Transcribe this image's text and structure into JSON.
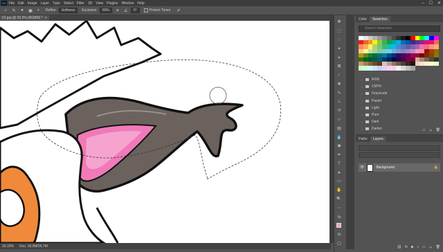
{
  "app": {
    "logo": "Ps"
  },
  "menu": [
    "File",
    "Edit",
    "Image",
    "Layer",
    "Type",
    "Select",
    "Filter",
    "3D",
    "View",
    "Plugins",
    "Window",
    "Help"
  ],
  "window_controls": [
    "–",
    "☐",
    "✕"
  ],
  "options_bar": {
    "feather_label": "Feather:",
    "feather_value": "0 px",
    "antialias_label": "Refine:",
    "mode_label": "Softness",
    "tolerance_label": "Exclusive:",
    "tolerance_value": "50%",
    "angle_value": "0°",
    "protect_label": "Protect Tones"
  },
  "document": {
    "tab_title": "01.jpg @ 33.3% (RGB/8) *",
    "status_zoom": "33.33%",
    "status_info": "Doc: 18.0M/26.7M"
  },
  "tools": [
    "move-icon",
    "marquee-icon",
    "lasso-icon",
    "quick-select-icon",
    "crop-icon",
    "frame-icon",
    "eyedropper-icon",
    "healing-icon",
    "brush-icon",
    "stamp-icon",
    "history-brush-icon",
    "eraser-icon",
    "gradient-icon",
    "blur-icon",
    "dodge-icon",
    "pen-icon",
    "type-icon",
    "path-select-icon",
    "shape-icon",
    "hand-icon",
    "zoom-icon",
    "more-icon",
    "swap-colors-icon",
    "color-fg-bg-icon",
    "quick-mask-icon",
    "screen-mode-icon"
  ],
  "swatches_panel": {
    "tabs": [
      "Color",
      "Swatches"
    ],
    "active_tab": "Swatches",
    "search_placeholder": "Search Swatches",
    "colors": [
      "#ffffff",
      "#e6e6e6",
      "#cccccc",
      "#b3b3b3",
      "#999999",
      "#808080",
      "#666666",
      "#4d4d4d",
      "#333333",
      "#1a1a1a",
      "#000000",
      "#ff0000",
      "#ffff00",
      "#00ff00",
      "#00ffff",
      "#0000ff",
      "#ff00ff",
      "#ed1c24",
      "#f26522",
      "#f7941d",
      "#fff200",
      "#8dc63f",
      "#39b54a",
      "#00a651",
      "#00a99d",
      "#00aeef",
      "#0072bc",
      "#0054a6",
      "#2e3192",
      "#662d91",
      "#92278f",
      "#ec008c",
      "#ed145b",
      "#f26c4f",
      "#f68e55",
      "#fbaf5c",
      "#fff467",
      "#acd372",
      "#7cc576",
      "#3bb878",
      "#1abbb4",
      "#00bff3",
      "#438cca",
      "#5574b9",
      "#605ca8",
      "#855fa8",
      "#a763a8",
      "#f06ea9",
      "#f26d7d",
      "#f69679",
      "#f9ad81",
      "#fdc68a",
      "#fff799",
      "#c4df9b",
      "#a3d39c",
      "#82ca9c",
      "#7accc8",
      "#6dcff6",
      "#7da7d9",
      "#8393ca",
      "#8781bd",
      "#a186be",
      "#bd8cbf",
      "#f49ac1",
      "#f5989d",
      "#9e0b0f",
      "#a0410d",
      "#a36209",
      "#aba000",
      "#598527",
      "#1a7b30",
      "#007236",
      "#00746b",
      "#0076a3",
      "#004b80",
      "#003471",
      "#1b1464",
      "#440e62",
      "#630460",
      "#9e005d",
      "#9e0039",
      "#790000",
      "#7b2e00",
      "#7d4900",
      "#827b00",
      "#406618",
      "#005e20",
      "#005826",
      "#005952",
      "#005b7f",
      "#003663",
      "#002157",
      "#0d004c",
      "#32004b",
      "#4b0049",
      "#7b0046",
      "#7a0026",
      "#c7b299",
      "#998675",
      "#736357",
      "#534741",
      "#37302d",
      "#c69c6d",
      "#a67c52",
      "#8c6239",
      "#754c24",
      "#603913",
      "#d4c6b0",
      "#b0a08a",
      "#8a7a66",
      "#6b5d4d",
      "#4d4236",
      "#2f2820",
      "#1a1511",
      "#ffcccc",
      "#ffe0cc",
      "#fff2cc",
      "#ffffcc",
      "#e6ffcc",
      "#ccffcc",
      "#ccffe6",
      "#ccffff",
      "#cce6ff",
      "#ccccff",
      "#e6ccff",
      "#ffccff",
      "#ffcce6",
      "#f2f2f2",
      "#d9d9d9",
      "#bfbfbf",
      "#a6a6a6"
    ],
    "folders": [
      "RGB",
      "CMYK",
      "Grayscale",
      "Pastel",
      "Light",
      "Pure",
      "Dark",
      "Darker"
    ]
  },
  "layers_panel": {
    "tabs": [
      "Paths",
      "Layers"
    ],
    "active_tab": "Layers",
    "layer_name": "Background"
  }
}
